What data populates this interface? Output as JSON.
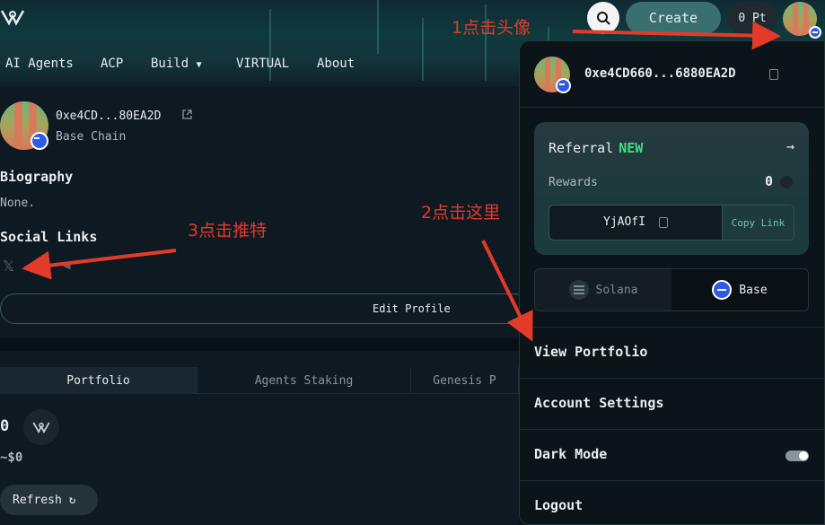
{
  "nav": {
    "items": [
      "AI Agents",
      "ACP",
      "Build",
      "VIRTUAL",
      "About"
    ]
  },
  "header": {
    "create_label": "Create",
    "points_label": "0 Pt"
  },
  "profile": {
    "address": "0xe4CD...80EA2D",
    "chain": "Base Chain",
    "biography_heading": "Biography",
    "biography_text": "None.",
    "social_heading": "Social Links",
    "edit_label": "Edit Profile"
  },
  "tabs": [
    "Portfolio",
    "Agents Staking",
    "Genesis P"
  ],
  "portfolio": {
    "balance": "0",
    "usd": "~$0",
    "refresh_label": "Refresh"
  },
  "dropdown": {
    "address": "0xe4CD660...6880EA2D",
    "referral_label": "Referral",
    "referral_new": "NEW",
    "rewards_label": "Rewards",
    "rewards_value": "0",
    "referral_code": "YjAOfI",
    "copy_link_label": "Copy Link",
    "chains": [
      "Solana",
      "Base"
    ],
    "selected_chain": "Base",
    "menu": {
      "view_portfolio": "View Portfolio",
      "account_settings": "Account Settings",
      "dark_mode": "Dark Mode",
      "logout": "Logout"
    },
    "dark_mode_on": true
  },
  "annotations": {
    "step1": "1点击头像",
    "step2": "2点击这里",
    "step3": "3点击推特"
  },
  "colors": {
    "accent_green": "#3ee07a",
    "annotation_red": "#e23b2a",
    "base_blue": "#2d5ae8"
  }
}
